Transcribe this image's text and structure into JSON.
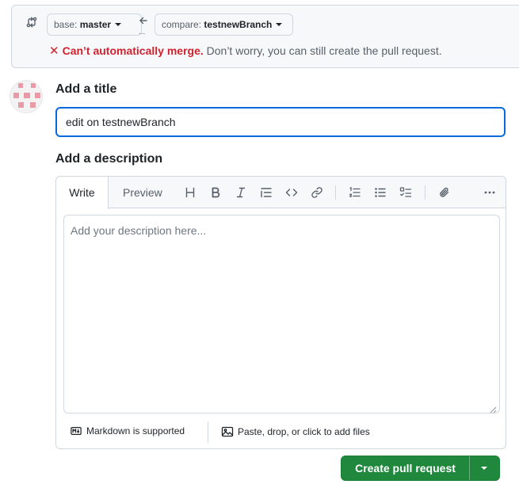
{
  "compare": {
    "base_label": "base: ",
    "base_value": "master",
    "compare_label": "compare: ",
    "compare_value": "testnewBranch",
    "dots": "...",
    "status_icon": "x-icon",
    "status_strong": "Can’t automatically merge.",
    "status_rest": " Don’t worry, you can still create the pull request.",
    "status_color": "#cf222e"
  },
  "form": {
    "title_heading": "Add a title",
    "title_value": "edit on testnewBranch",
    "description_heading": "Add a description",
    "description_placeholder": "Add your description here..."
  },
  "editor": {
    "tabs": [
      "Write",
      "Preview"
    ],
    "active_tab": "Write",
    "toolbar": [
      "heading-icon",
      "bold-icon",
      "italic-icon",
      "quote-icon",
      "code-icon",
      "link-icon",
      "ordered-list-icon",
      "unordered-list-icon",
      "task-list-icon",
      "attach-icon",
      "more-icon"
    ],
    "markdown_note": "Markdown is supported",
    "attach_note": "Paste, drop, or click to add files"
  },
  "actions": {
    "create_label": "Create pull request",
    "primary_color": "#1f883d"
  }
}
